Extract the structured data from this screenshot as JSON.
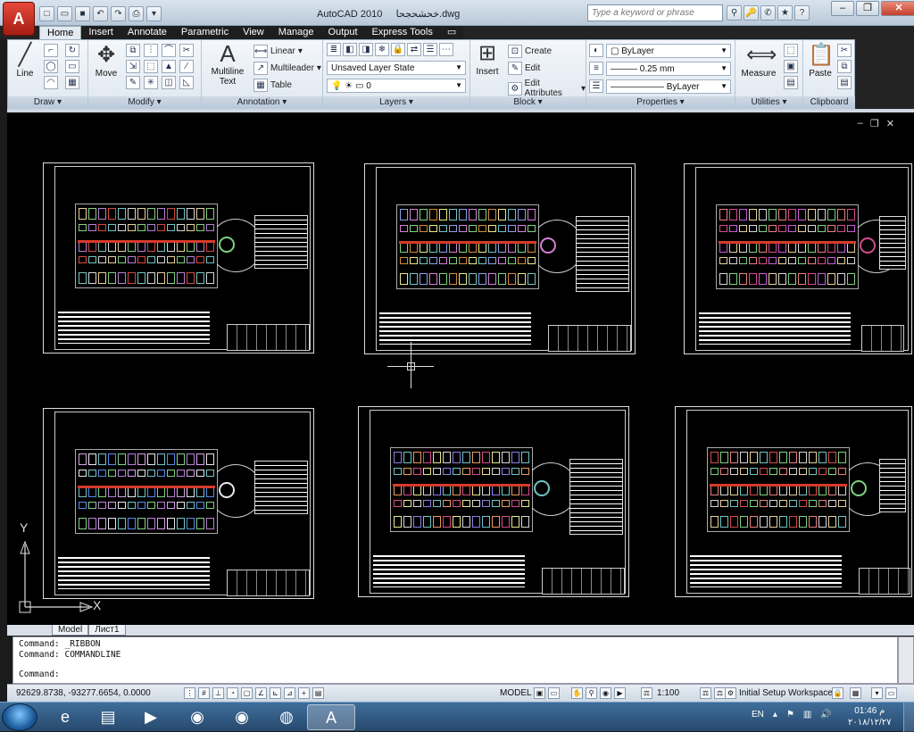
{
  "window": {
    "title": "AutoCAD 2010",
    "filename": "خحشحجحا.dwg",
    "app_letter": "A"
  },
  "search": {
    "placeholder": "Type a keyword or phrase"
  },
  "tabs": [
    "Home",
    "Insert",
    "Annotate",
    "Parametric",
    "View",
    "Manage",
    "Output",
    "Express Tools"
  ],
  "ribbon": {
    "draw": {
      "label": "Draw",
      "line": "Line"
    },
    "modify": {
      "label": "Modify",
      "move": "Move"
    },
    "annotation": {
      "label": "Annotation",
      "mtext1": "Multiline",
      "mtext2": "Text",
      "linear": "Linear",
      "multileader": "Multileader",
      "table": "Table"
    },
    "layers": {
      "label": "Layers",
      "state": "Unsaved Layer State",
      "layer": "0"
    },
    "block": {
      "label": "Block",
      "insert": "Insert",
      "create": "Create",
      "edit": "Edit",
      "edit_attributes": "Edit Attributes"
    },
    "properties": {
      "label": "Properties",
      "color": "ByLayer",
      "lineweight": "0.25 mm",
      "linetype": "ByLayer"
    },
    "utilities": {
      "label": "Utilities",
      "measure": "Measure"
    },
    "clipboard": {
      "label": "Clipboard",
      "paste": "Paste"
    }
  },
  "layout_tabs": [
    "Model",
    "Лист1"
  ],
  "ucs": {
    "x": "X",
    "y": "Y"
  },
  "command": {
    "lines": [
      "Command:  _RIBBON",
      "Command:  COMMANDLINE"
    ],
    "prompt": "Command:"
  },
  "status": {
    "coords": "92629.8738, -93277.6654, 0.0000",
    "model": "MODEL",
    "scale": "1:100",
    "workspace": "Initial Setup Workspace"
  },
  "tray": {
    "lang": "EN"
  },
  "clock": {
    "time": "01:46 م",
    "date": "۲۰۱۸/۱۲/۲۷"
  },
  "colors": {
    "accent": "#c3412b",
    "canvas": "#000000",
    "ribbon": "#e4eaf1"
  }
}
